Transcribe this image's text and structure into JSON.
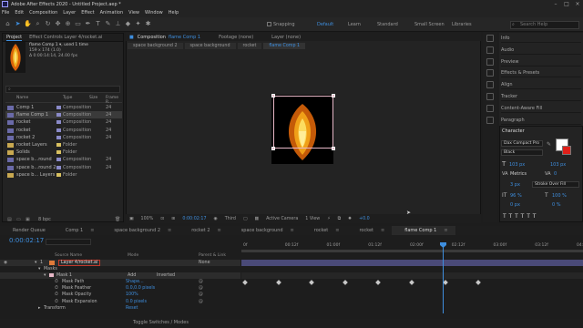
{
  "window": {
    "title": "Adobe After Effects 2020 - Untitled Project.aep *"
  },
  "menu": [
    "File",
    "Edit",
    "Composition",
    "Layer",
    "Effect",
    "Animation",
    "View",
    "Window",
    "Help"
  ],
  "toolbar": {
    "snapping_label": "Snapping",
    "workspaces": [
      "Default",
      "Learn",
      "Standard",
      "Small Screen",
      "Libraries"
    ],
    "search_placeholder": "Search Help"
  },
  "project": {
    "tab_label": "Project",
    "effect_controls_label": "Effect Controls Layer 4/rocket.ai",
    "selected_name": "flame Comp 1 ▾, used 1 time",
    "selected_info1": "159 x 174 (1.0)",
    "selected_info2": "Δ 0:00:14:14, 24.00 fps",
    "columns": {
      "name": "Name",
      "type": "Type",
      "size": "Size",
      "fps": "Frame R..."
    },
    "items": [
      {
        "name": "Comp 1",
        "type": "Composition",
        "fps": "24",
        "color": "#8a8ac8",
        "kind": "comp"
      },
      {
        "name": "flame Comp 1",
        "type": "Composition",
        "fps": "24",
        "color": "#8a8ac8",
        "kind": "comp"
      },
      {
        "name": "rocket",
        "type": "Composition",
        "fps": "24",
        "color": "#8a8ac8",
        "kind": "comp"
      },
      {
        "name": "rocket",
        "type": "Composition",
        "fps": "24",
        "color": "#8a8ac8",
        "kind": "comp"
      },
      {
        "name": "rocket 2",
        "type": "Composition",
        "fps": "24",
        "color": "#8a8ac8",
        "kind": "comp"
      },
      {
        "name": "rocket Layers",
        "type": "Folder",
        "fps": "",
        "color": "#d8c060",
        "kind": "folder"
      },
      {
        "name": "Solids",
        "type": "Folder",
        "fps": "",
        "color": "#d8c060",
        "kind": "folder"
      },
      {
        "name": "space b...round",
        "type": "Composition",
        "fps": "24",
        "color": "#8a8ac8",
        "kind": "comp"
      },
      {
        "name": "space b...round 2",
        "type": "Composition",
        "fps": "24",
        "color": "#8a8ac8",
        "kind": "comp"
      },
      {
        "name": "space b... Layers",
        "type": "Folder",
        "fps": "",
        "color": "#d8c060",
        "kind": "folder"
      }
    ],
    "bit_depth": "8 bpc"
  },
  "composition": {
    "tab_label": "Composition",
    "active_comp": "flame Comp 1",
    "footage_label": "Footage (none)",
    "layer_label": "Layer (none)",
    "breadcrumbs": [
      "space background 2",
      "space background",
      "rocket",
      "flame Comp 1"
    ],
    "zoom": "100%",
    "timecode": "0:00:02:17",
    "resolution": "Third",
    "camera": "Active Camera",
    "views": "1 View",
    "exposure": "+0.0"
  },
  "right_panels": [
    "Info",
    "Audio",
    "Preview",
    "Effects & Presets",
    "Align",
    "Tracker",
    "Content-Aware Fill",
    "Paragraph"
  ],
  "character": {
    "title": "Character",
    "font": "Dax Compact Pro",
    "style": "Black",
    "size": "103 px",
    "leading": "103 px",
    "kerning": "Metrics",
    "tracking": "0",
    "stroke_width": "3 px",
    "stroke_mode": "Stroke Over Fill",
    "vscale": "96 %",
    "hscale": "100 %",
    "baseline": "0 px",
    "tsume": "0 %"
  },
  "timeline": {
    "tabs": [
      "Render Queue",
      "Comp 1",
      "space background 2",
      "rocket 2",
      "space background",
      "rocket",
      "rocket",
      "flame Comp 1"
    ],
    "active_tab": "flame Comp 1",
    "timecode": "0:00:02:17",
    "columns": {
      "name": "Source Name",
      "mode": "Mode",
      "parent": "Parent & Link"
    },
    "layer": {
      "index": "1",
      "name": "Layer 4/rocket.ai",
      "parent": "None"
    },
    "masks_label": "Masks",
    "mask1": {
      "name": "Mask 1",
      "mode": "Add",
      "inverted": "Inverted"
    },
    "properties": [
      {
        "name": "Mask Path",
        "value": "Shape..."
      },
      {
        "name": "Mask Feather",
        "value": "0.0,0.0 pixels"
      },
      {
        "name": "Mask Opacity",
        "value": "100%"
      },
      {
        "name": "Mask Expansion",
        "value": "0.0 pixels"
      }
    ],
    "transform_label": "Transform",
    "transform_value": "Reset",
    "ruler_ticks": [
      "0f",
      "00:12f",
      "01:00f",
      "01:12f",
      "02:00f",
      "02:12f",
      "03:00f",
      "03:12f",
      "04:0"
    ],
    "footer": "Toggle Switches / Modes",
    "colors": {
      "accent": "#3e8ede",
      "label": "#8a8ac8"
    }
  }
}
